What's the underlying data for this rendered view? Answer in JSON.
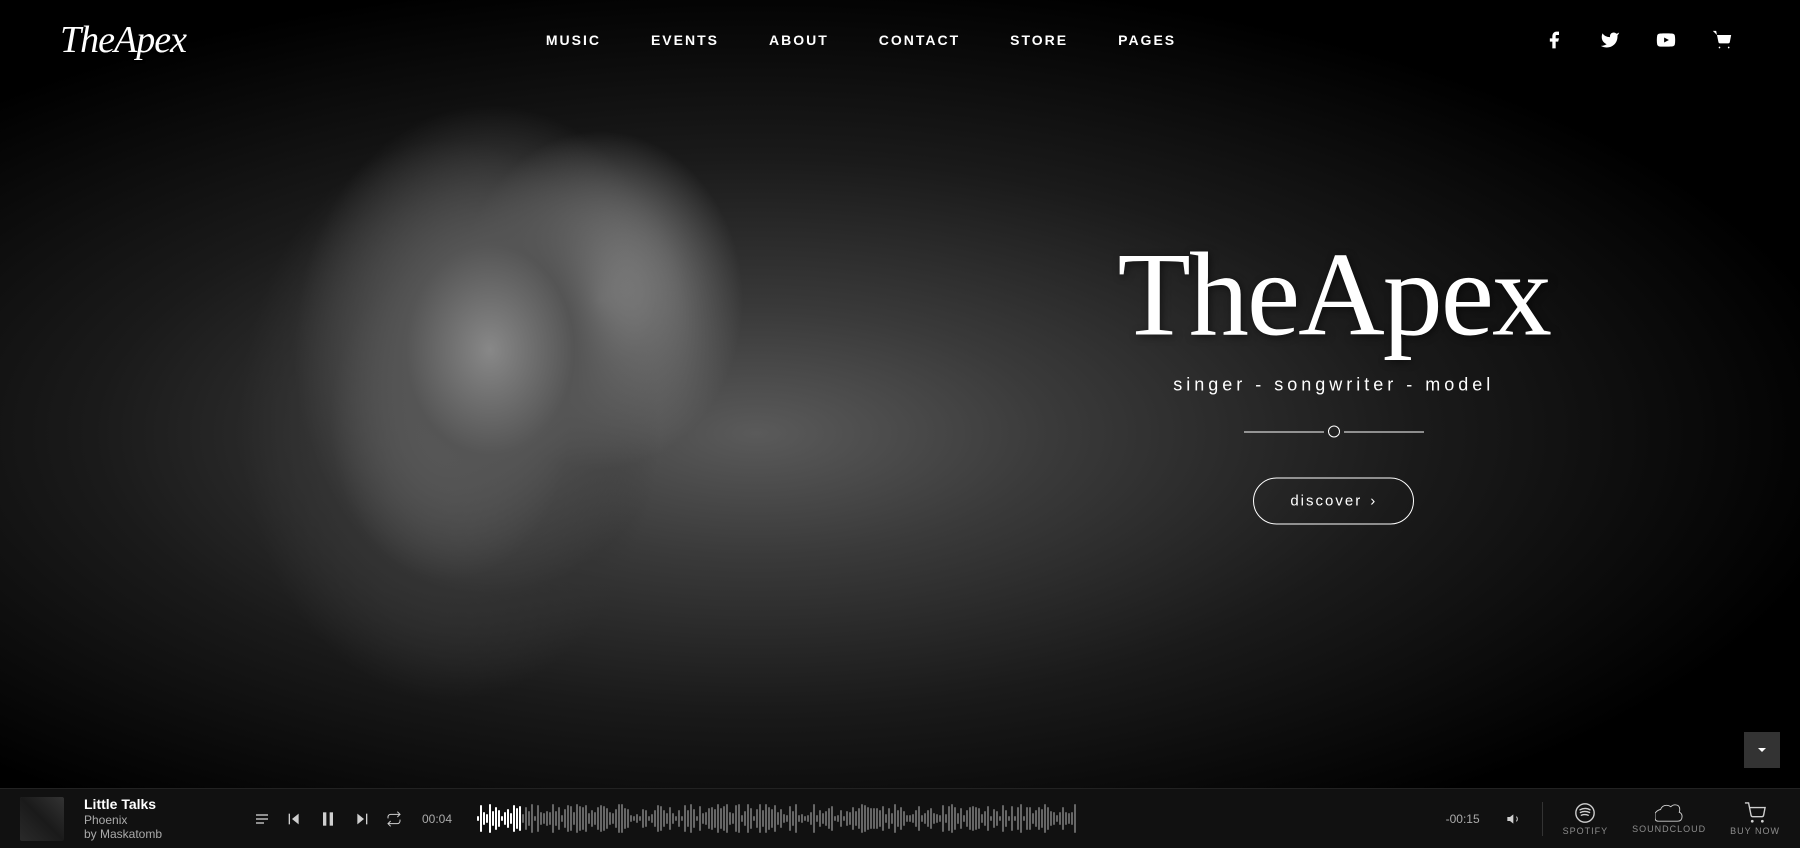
{
  "site": {
    "logo": "TheApex",
    "tagline": "singer - songwriter - model"
  },
  "nav": {
    "links": [
      {
        "label": "MUSIC",
        "id": "music"
      },
      {
        "label": "EVENTS",
        "id": "events"
      },
      {
        "label": "ABOUT",
        "id": "about"
      },
      {
        "label": "CONTACT",
        "id": "contact"
      },
      {
        "label": "STORE",
        "id": "store"
      },
      {
        "label": "PAGES",
        "id": "pages"
      }
    ],
    "social": [
      {
        "icon": "facebook",
        "label": "Facebook"
      },
      {
        "icon": "twitter",
        "label": "Twitter"
      },
      {
        "icon": "youtube",
        "label": "YouTube"
      },
      {
        "icon": "cart",
        "label": "Cart"
      }
    ]
  },
  "hero": {
    "title": "TheApex",
    "subtitle": "singer - songwriter - model",
    "cta_label": "discover",
    "cta_arrow": "›"
  },
  "player": {
    "track_title": "Little Talks",
    "track_artist": "Phoenix",
    "track_by": "by Maskatomb",
    "current_time": "00:04",
    "end_time": "-00:15",
    "platforms": [
      {
        "label": "SPOTIFY",
        "icon": "spotify"
      },
      {
        "label": "SOUNDCLOUD",
        "icon": "soundcloud"
      },
      {
        "label": "BUY NOW",
        "icon": "cart"
      }
    ]
  },
  "scroll_indicator": "∨"
}
